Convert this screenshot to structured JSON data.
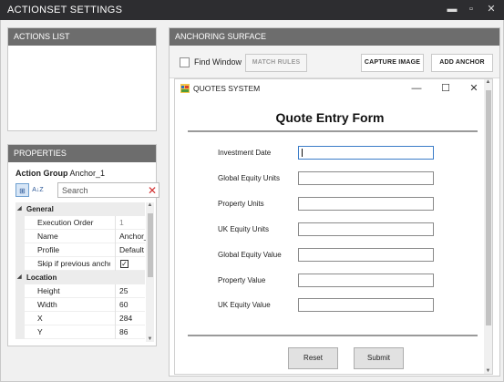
{
  "window": {
    "title": "ACTIONSET SETTINGS",
    "minimize_glyph": "▬",
    "maximize_glyph": "▫",
    "close_glyph": "✕"
  },
  "actions_list": {
    "header": "ACTIONS LIST"
  },
  "properties": {
    "header": "PROPERTIES",
    "object_type": "Action Group",
    "object_name": "Anchor_1",
    "search_placeholder": "Search",
    "categorized_icon": "⊞",
    "alphabetical_icon": "A↓Z",
    "clear_glyph": "✕",
    "categories": [
      {
        "name": "General",
        "props": [
          {
            "label": "Execution Order",
            "value": "1"
          },
          {
            "label": "Name",
            "value": "Anchor_"
          },
          {
            "label": "Profile",
            "value": "Default"
          },
          {
            "label": "Skip if previous anchor...",
            "value": "✓"
          }
        ]
      },
      {
        "name": "Location",
        "props": [
          {
            "label": "Height",
            "value": "25"
          },
          {
            "label": "Width",
            "value": "60"
          },
          {
            "label": "X",
            "value": "284"
          },
          {
            "label": "Y",
            "value": "86"
          }
        ]
      }
    ]
  },
  "anchoring_surface": {
    "header": "ANCHORING SURFACE",
    "find_window_label": "Find Window",
    "match_rules_label": "MATCH RULES",
    "capture_image_label": "CAPTURE IMAGE",
    "add_anchor_label": "ADD ANCHOR"
  },
  "quotes_app": {
    "title": "QUOTES SYSTEM",
    "minimize_glyph": "—",
    "maximize_glyph": "☐",
    "close_glyph": "✕",
    "form_title": "Quote Entry Form",
    "fields": [
      {
        "label": "Investment Date",
        "value": ""
      },
      {
        "label": "Global Equity Units",
        "value": ""
      },
      {
        "label": "Property Units",
        "value": ""
      },
      {
        "label": "UK Equity Units",
        "value": ""
      },
      {
        "label": "Global Equity Value",
        "value": ""
      },
      {
        "label": "Property Value",
        "value": ""
      },
      {
        "label": "UK Equity Value",
        "value": ""
      }
    ],
    "reset_label": "Reset",
    "submit_label": "Submit"
  },
  "colors": {
    "titlebar": "#2d2d30",
    "panel_header": "#6d6d6d",
    "accent_focus": "#3b7cc8",
    "clear_icon": "#d23030"
  }
}
